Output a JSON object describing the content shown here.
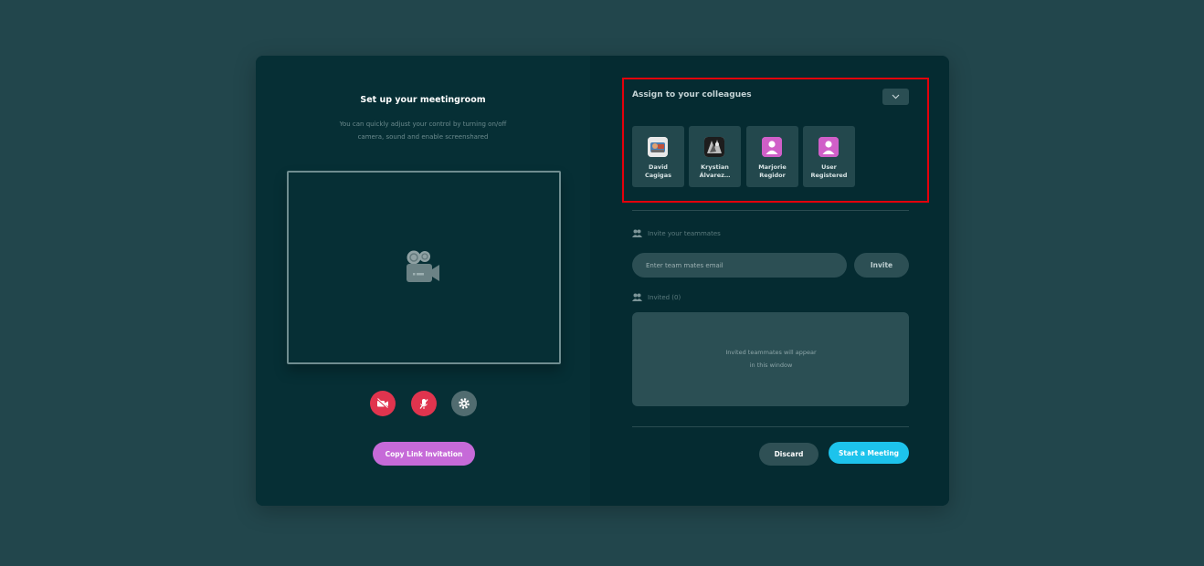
{
  "setup": {
    "title": "Set up your meetingroom",
    "subtitle_line1": "You can quickly adjust your control by turning on/off",
    "subtitle_line2": "camera, sound and enable screenshared",
    "copy_link_label": "Copy Link Invitation"
  },
  "controls": [
    {
      "icon": "camera-off-icon",
      "color": "#e0344e"
    },
    {
      "icon": "mic-off-icon",
      "color": "#e0344e"
    },
    {
      "icon": "gear-icon",
      "color": "#516c70"
    }
  ],
  "assign": {
    "title": "Assign to your colleagues",
    "colleagues": [
      {
        "line1": "David",
        "line2": "Cagigas"
      },
      {
        "line1": "Krystian",
        "line2": "Álvarez…"
      },
      {
        "line1": "Marjorie",
        "line2": "Regidor"
      },
      {
        "line1": "User",
        "line2": "Registered"
      }
    ]
  },
  "invite": {
    "label": "Invite your teammates",
    "placeholder": "Enter team mates email",
    "button_label": "Invite"
  },
  "invited": {
    "label": "Invited (0)",
    "empty_line1": "Invited teammates will appear",
    "empty_line2": "in this window"
  },
  "footer": {
    "discard_label": "Discard",
    "start_label": "Start a Meeting"
  },
  "colors": {
    "background": "#22464c",
    "panel": "#062f35",
    "accent_primary": "#1dc3ec",
    "accent_purple": "#c66ad8",
    "danger": "#e0344e",
    "highlight": "#e3000b"
  }
}
